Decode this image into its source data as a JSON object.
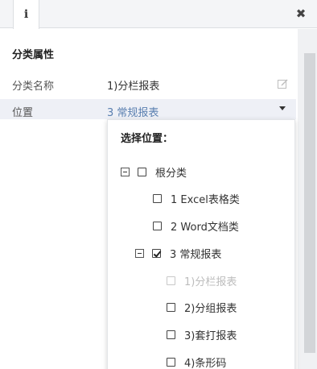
{
  "tabs": {
    "info_label": "i"
  },
  "close_label": "✖",
  "section": {
    "title": "分类属性"
  },
  "fields": {
    "name_label": "分类名称",
    "name_value": "1)分栏报表",
    "position_label": "位置",
    "position_value": "3 常规报表"
  },
  "dropdown": {
    "title": "选择位置：",
    "tree": {
      "root": {
        "label": "根分类",
        "checked": false
      },
      "item1": {
        "label": "1 Excel表格类",
        "checked": false
      },
      "item2": {
        "label": "2 Word文档类",
        "checked": false
      },
      "item3": {
        "label": "3 常规报表",
        "checked": true
      },
      "child1": {
        "label": "1)分栏报表",
        "disabled": true
      },
      "child2": {
        "label": "2)分组报表",
        "checked": false
      },
      "child3": {
        "label": "3)套打报表",
        "checked": false
      },
      "child4": {
        "label": "4)条形码",
        "checked": false
      }
    }
  },
  "colors": {
    "position_value": "#5a7fb0",
    "position_row_bg": "#eef0f6",
    "disabled_text": "#bdbdbd"
  },
  "icons": {
    "info": "info-icon",
    "close": "close-icon",
    "edit": "edit-icon",
    "dropdown": "caret-down-icon",
    "collapse": "collapse-icon",
    "checkbox": "checkbox-icon"
  }
}
